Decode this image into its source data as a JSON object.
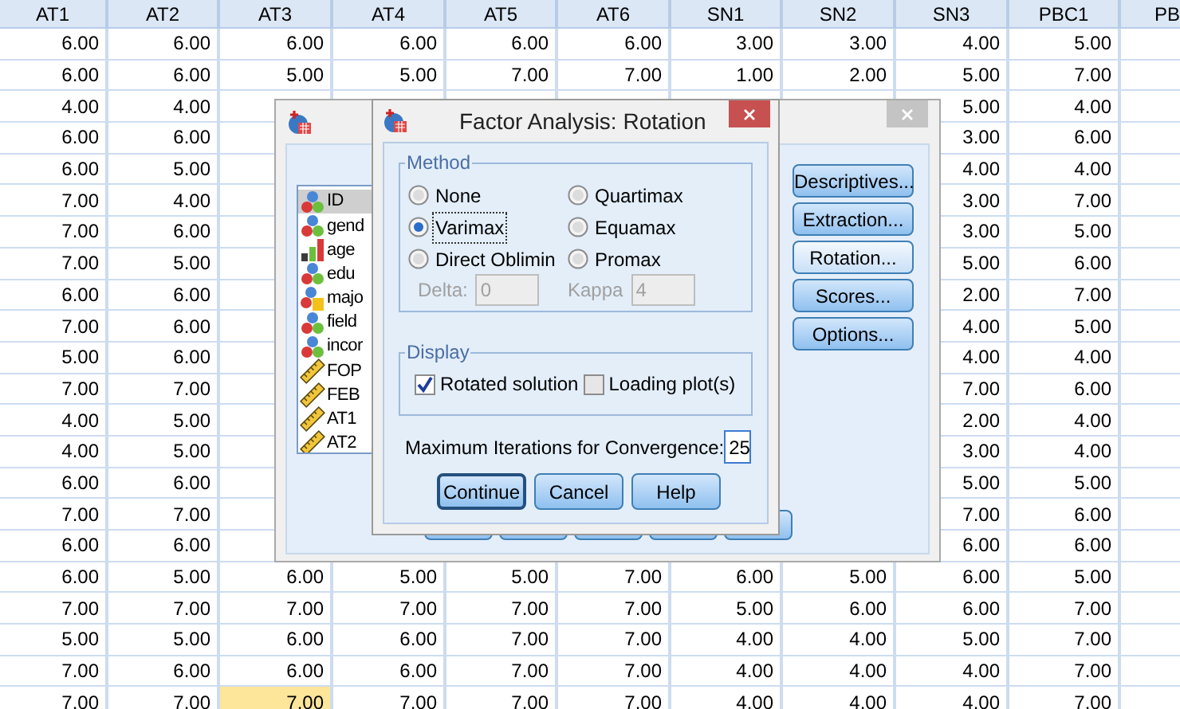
{
  "data_view": {
    "columns": [
      "AT1",
      "AT2",
      "AT3",
      "AT4",
      "AT5",
      "AT6",
      "SN1",
      "SN2",
      "SN3",
      "PBC1",
      "PB"
    ],
    "rows": [
      {
        "cells": [
          {
            "v": "6.00",
            "selected": false
          },
          {
            "v": "6.00",
            "selected": false
          },
          {
            "v": "6.00",
            "selected": false
          },
          {
            "v": "6.00",
            "selected": false
          },
          {
            "v": "6.00",
            "selected": false
          },
          {
            "v": "6.00",
            "selected": false
          },
          {
            "v": "3.00",
            "selected": false
          },
          {
            "v": "3.00",
            "selected": false
          },
          {
            "v": "4.00",
            "selected": false
          },
          {
            "v": "5.00",
            "selected": false
          }
        ]
      },
      {
        "cells": [
          {
            "v": "6.00",
            "selected": false
          },
          {
            "v": "6.00",
            "selected": false
          },
          {
            "v": "5.00",
            "selected": false
          },
          {
            "v": "5.00",
            "selected": false
          },
          {
            "v": "7.00",
            "selected": false
          },
          {
            "v": "7.00",
            "selected": false
          },
          {
            "v": "1.00",
            "selected": false
          },
          {
            "v": "2.00",
            "selected": false
          },
          {
            "v": "5.00",
            "selected": false
          },
          {
            "v": "7.00",
            "selected": false
          }
        ]
      },
      {
        "cells": [
          {
            "v": "4.00",
            "selected": false
          },
          {
            "v": "4.00",
            "selected": false
          },
          null,
          null,
          null,
          null,
          null,
          null,
          {
            "v": "5.00",
            "selected": false
          },
          {
            "v": "4.00",
            "selected": false
          }
        ]
      },
      {
        "cells": [
          {
            "v": "6.00",
            "selected": false
          },
          {
            "v": "6.00",
            "selected": false
          },
          null,
          null,
          null,
          null,
          null,
          null,
          {
            "v": "3.00",
            "selected": false
          },
          {
            "v": "6.00",
            "selected": false
          }
        ]
      },
      {
        "cells": [
          {
            "v": "6.00",
            "selected": false
          },
          {
            "v": "5.00",
            "selected": false
          },
          null,
          null,
          null,
          null,
          null,
          null,
          {
            "v": "4.00",
            "selected": false
          },
          {
            "v": "4.00",
            "selected": false
          }
        ]
      },
      {
        "cells": [
          {
            "v": "7.00",
            "selected": false
          },
          {
            "v": "4.00",
            "selected": false
          },
          null,
          null,
          null,
          null,
          null,
          null,
          {
            "v": "3.00",
            "selected": false
          },
          {
            "v": "7.00",
            "selected": false
          }
        ]
      },
      {
        "cells": [
          {
            "v": "7.00",
            "selected": false
          },
          {
            "v": "6.00",
            "selected": false
          },
          null,
          null,
          null,
          null,
          null,
          null,
          {
            "v": "3.00",
            "selected": false
          },
          {
            "v": "5.00",
            "selected": false
          }
        ]
      },
      {
        "cells": [
          {
            "v": "7.00",
            "selected": false
          },
          {
            "v": "5.00",
            "selected": false
          },
          null,
          null,
          null,
          null,
          null,
          null,
          {
            "v": "5.00",
            "selected": false
          },
          {
            "v": "6.00",
            "selected": false
          }
        ]
      },
      {
        "cells": [
          {
            "v": "6.00",
            "selected": false
          },
          {
            "v": "6.00",
            "selected": false
          },
          null,
          null,
          null,
          null,
          null,
          null,
          {
            "v": "2.00",
            "selected": false
          },
          {
            "v": "7.00",
            "selected": false
          }
        ]
      },
      {
        "cells": [
          {
            "v": "7.00",
            "selected": false
          },
          {
            "v": "6.00",
            "selected": false
          },
          null,
          null,
          null,
          null,
          null,
          null,
          {
            "v": "4.00",
            "selected": false
          },
          {
            "v": "5.00",
            "selected": false
          }
        ]
      },
      {
        "cells": [
          {
            "v": "5.00",
            "selected": false
          },
          {
            "v": "6.00",
            "selected": false
          },
          null,
          null,
          null,
          null,
          null,
          null,
          {
            "v": "4.00",
            "selected": false
          },
          {
            "v": "4.00",
            "selected": false
          }
        ]
      },
      {
        "cells": [
          {
            "v": "7.00",
            "selected": false
          },
          {
            "v": "7.00",
            "selected": false
          },
          null,
          null,
          null,
          null,
          null,
          null,
          {
            "v": "7.00",
            "selected": false
          },
          {
            "v": "6.00",
            "selected": false
          }
        ]
      },
      {
        "cells": [
          {
            "v": "4.00",
            "selected": false
          },
          {
            "v": "5.00",
            "selected": false
          },
          null,
          null,
          null,
          null,
          null,
          null,
          {
            "v": "2.00",
            "selected": false
          },
          {
            "v": "4.00",
            "selected": false
          }
        ]
      },
      {
        "cells": [
          {
            "v": "4.00",
            "selected": false
          },
          {
            "v": "5.00",
            "selected": false
          },
          null,
          null,
          null,
          null,
          null,
          null,
          {
            "v": "3.00",
            "selected": false
          },
          {
            "v": "4.00",
            "selected": false
          }
        ]
      },
      {
        "cells": [
          {
            "v": "6.00",
            "selected": false
          },
          {
            "v": "6.00",
            "selected": false
          },
          null,
          null,
          null,
          null,
          null,
          null,
          {
            "v": "5.00",
            "selected": false
          },
          {
            "v": "5.00",
            "selected": false
          }
        ]
      },
      {
        "cells": [
          {
            "v": "7.00",
            "selected": false
          },
          {
            "v": "7.00",
            "selected": false
          },
          null,
          null,
          null,
          null,
          null,
          null,
          {
            "v": "7.00",
            "selected": false
          },
          {
            "v": "6.00",
            "selected": false
          }
        ]
      },
      {
        "cells": [
          {
            "v": "6.00",
            "selected": false
          },
          {
            "v": "6.00",
            "selected": false
          },
          null,
          null,
          null,
          null,
          null,
          null,
          {
            "v": "6.00",
            "selected": false
          },
          {
            "v": "6.00",
            "selected": false
          }
        ]
      },
      {
        "cells": [
          {
            "v": "6.00",
            "selected": false
          },
          {
            "v": "5.00",
            "selected": false
          },
          {
            "v": "6.00",
            "selected": false
          },
          {
            "v": "5.00",
            "selected": false
          },
          {
            "v": "5.00",
            "selected": false
          },
          {
            "v": "7.00",
            "selected": false
          },
          {
            "v": "6.00",
            "selected": false
          },
          {
            "v": "5.00",
            "selected": false
          },
          {
            "v": "6.00",
            "selected": false
          },
          {
            "v": "5.00",
            "selected": false
          }
        ]
      },
      {
        "cells": [
          {
            "v": "7.00",
            "selected": false
          },
          {
            "v": "7.00",
            "selected": false
          },
          {
            "v": "7.00",
            "selected": false
          },
          {
            "v": "7.00",
            "selected": false
          },
          {
            "v": "7.00",
            "selected": false
          },
          {
            "v": "7.00",
            "selected": false
          },
          {
            "v": "5.00",
            "selected": false
          },
          {
            "v": "6.00",
            "selected": false
          },
          {
            "v": "6.00",
            "selected": false
          },
          {
            "v": "7.00",
            "selected": false
          }
        ]
      },
      {
        "cells": [
          {
            "v": "5.00",
            "selected": false
          },
          {
            "v": "5.00",
            "selected": false
          },
          {
            "v": "6.00",
            "selected": false
          },
          {
            "v": "6.00",
            "selected": false
          },
          {
            "v": "7.00",
            "selected": false
          },
          {
            "v": "7.00",
            "selected": false
          },
          {
            "v": "4.00",
            "selected": false
          },
          {
            "v": "4.00",
            "selected": false
          },
          {
            "v": "5.00",
            "selected": false
          },
          {
            "v": "7.00",
            "selected": false
          }
        ]
      },
      {
        "cells": [
          {
            "v": "7.00",
            "selected": false
          },
          {
            "v": "6.00",
            "selected": false
          },
          {
            "v": "6.00",
            "selected": false
          },
          {
            "v": "6.00",
            "selected": false
          },
          {
            "v": "7.00",
            "selected": false
          },
          {
            "v": "7.00",
            "selected": false
          },
          {
            "v": "4.00",
            "selected": false
          },
          {
            "v": "4.00",
            "selected": false
          },
          {
            "v": "4.00",
            "selected": false
          },
          {
            "v": "7.00",
            "selected": false
          }
        ]
      },
      {
        "cells": [
          {
            "v": "7.00",
            "selected": false
          },
          {
            "v": "7.00",
            "selected": false
          },
          {
            "v": "7.00",
            "selected": true
          },
          {
            "v": "7.00",
            "selected": false
          },
          {
            "v": "7.00",
            "selected": false
          },
          {
            "v": "7.00",
            "selected": false
          },
          {
            "v": "4.00",
            "selected": false
          },
          {
            "v": "4.00",
            "selected": false
          },
          {
            "v": "4.00",
            "selected": false
          },
          {
            "v": "7.00",
            "selected": false
          }
        ]
      }
    ]
  },
  "factor_dialog": {
    "variables": [
      {
        "name": "ID",
        "kind": "nominal",
        "selected": true
      },
      {
        "name": "gend",
        "kind": "nominal",
        "selected": false
      },
      {
        "name": "age",
        "kind": "ordinal",
        "selected": false
      },
      {
        "name": "edu",
        "kind": "nominal",
        "selected": false
      },
      {
        "name": "majo",
        "kind": "string",
        "selected": false
      },
      {
        "name": "field",
        "kind": "nominal",
        "selected": false
      },
      {
        "name": "incor",
        "kind": "nominal",
        "selected": false
      },
      {
        "name": "FOP",
        "kind": "scale",
        "selected": false
      },
      {
        "name": "FEB",
        "kind": "scale",
        "selected": false
      },
      {
        "name": "AT1",
        "kind": "scale",
        "selected": false
      },
      {
        "name": "AT2",
        "kind": "scale",
        "selected": false
      }
    ],
    "buttons": [
      {
        "label": "Descriptives...",
        "active": false
      },
      {
        "label": "Extraction...",
        "active": false
      },
      {
        "label": "Rotation...",
        "active": true
      },
      {
        "label": "Scores...",
        "active": false
      },
      {
        "label": "Options...",
        "active": false
      }
    ]
  },
  "rotation_dialog": {
    "title": "Factor Analysis: Rotation",
    "method": {
      "title": "Method",
      "options": [
        {
          "label": "None",
          "selected": false,
          "focused": false
        },
        {
          "label": "Quartimax",
          "selected": false,
          "focused": false
        },
        {
          "label": "Varimax",
          "selected": true,
          "focused": true
        },
        {
          "label": "Equamax",
          "selected": false,
          "focused": false
        },
        {
          "label": "Direct Oblimin",
          "selected": false,
          "focused": false
        },
        {
          "label": "Promax",
          "selected": false,
          "focused": false
        }
      ],
      "delta": {
        "label": "Delta:",
        "value": "0",
        "disabled": true
      },
      "kappa": {
        "label": "Kappa",
        "value": "4",
        "disabled": true
      }
    },
    "display": {
      "title": "Display",
      "options": [
        {
          "label": "Rotated solution",
          "checked": true
        },
        {
          "label": "Loading plot(s)",
          "checked": false
        }
      ]
    },
    "max_iterations": {
      "label": "Maximum Iterations for Convergence:",
      "value": "25"
    },
    "buttons": [
      {
        "label": "Continue",
        "default": true
      },
      {
        "label": "Cancel",
        "default": false
      },
      {
        "label": "Help",
        "default": false
      }
    ]
  }
}
